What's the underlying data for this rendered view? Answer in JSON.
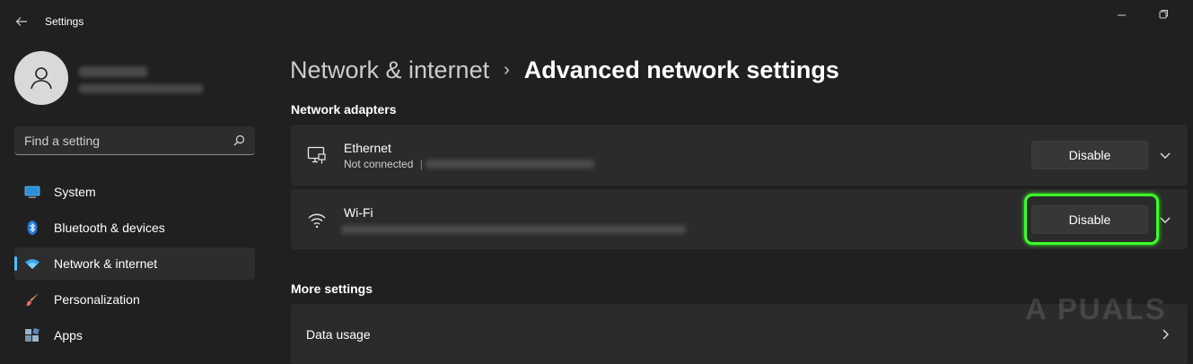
{
  "window": {
    "title": "Settings"
  },
  "search": {
    "placeholder": "Find a setting"
  },
  "sidebar": {
    "items": [
      {
        "label": "System"
      },
      {
        "label": "Bluetooth & devices"
      },
      {
        "label": "Network & internet",
        "active": true
      },
      {
        "label": "Personalization"
      },
      {
        "label": "Apps"
      }
    ]
  },
  "breadcrumb": {
    "parent": "Network & internet",
    "separator": "›",
    "current": "Advanced network settings"
  },
  "sections": {
    "adapters_title": "Network adapters",
    "more_title": "More settings"
  },
  "adapters": [
    {
      "name": "Ethernet",
      "status": "Not connected",
      "button_label": "Disable",
      "icon": "ethernet-icon"
    },
    {
      "name": "Wi-Fi",
      "button_label": "Disable",
      "icon": "wifi-icon"
    }
  ],
  "more_settings": [
    {
      "label": "Data usage"
    }
  ],
  "watermark": "A PUALS",
  "colors": {
    "accent": "#4cc2ff",
    "highlight": "#3cff2a",
    "background": "#202020",
    "card": "#2b2b2b"
  }
}
